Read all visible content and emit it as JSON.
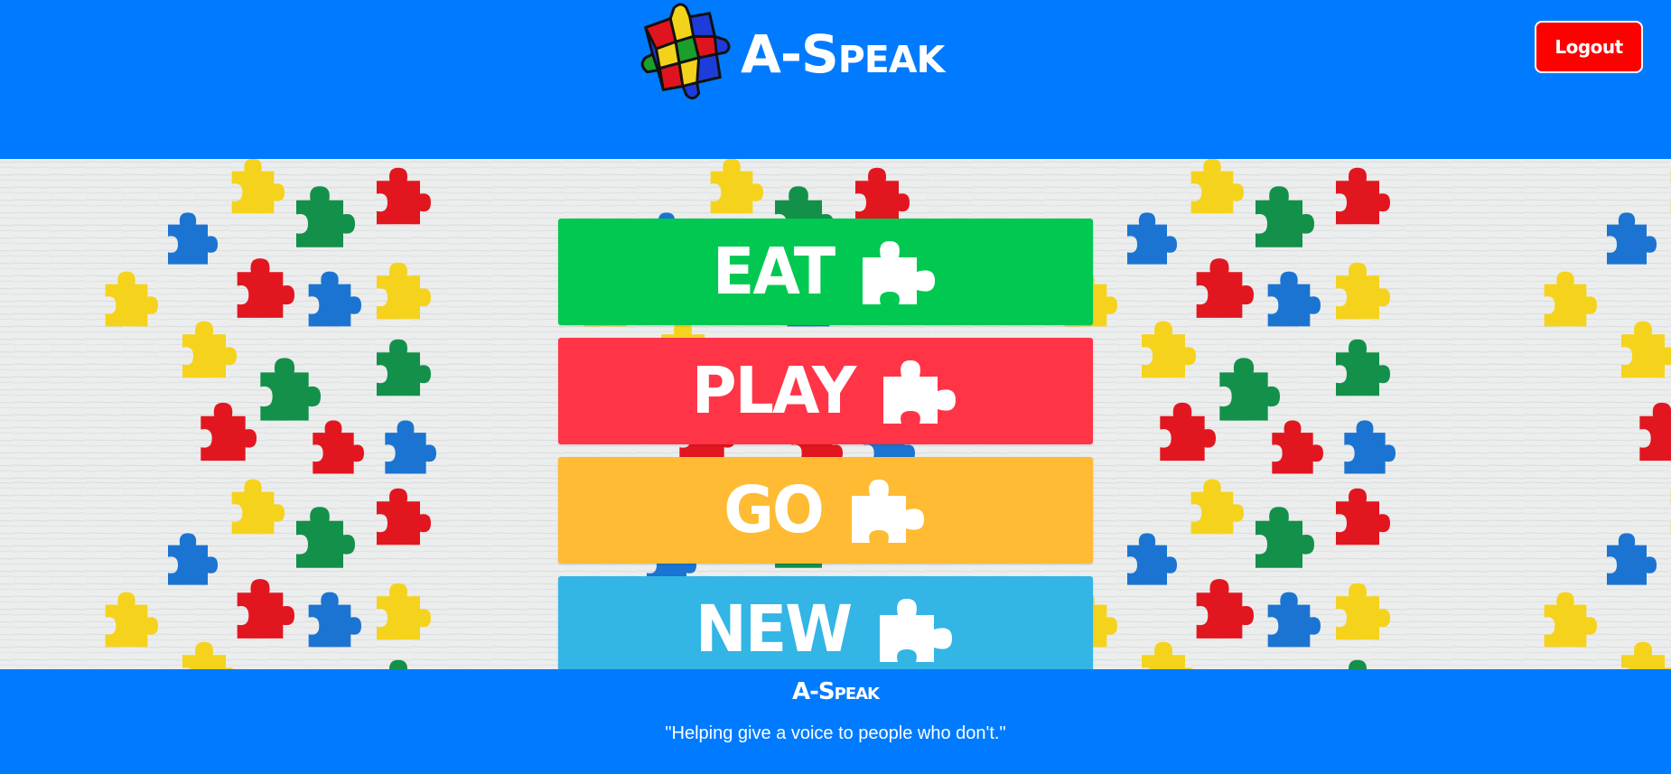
{
  "header": {
    "title": "A-Speak",
    "logout_label": "Logout",
    "logo_icon": "puzzle-logo-icon"
  },
  "menu": {
    "items": [
      {
        "label": "EAT",
        "color": "#00c851",
        "icon": "puzzle-piece-icon"
      },
      {
        "label": "PLAY",
        "color": "#ff3547",
        "icon": "puzzle-piece-icon"
      },
      {
        "label": "GO",
        "color": "#ffbb33",
        "icon": "puzzle-piece-icon"
      },
      {
        "label": "NEW",
        "color": "#33b5e5",
        "icon": "puzzle-piece-icon"
      }
    ]
  },
  "footer": {
    "title": "A-Speak",
    "tagline": "\"Helping give a voice to people who don't.\""
  },
  "colors": {
    "brand_blue": "#007bff",
    "logout_red": "#ff0000",
    "background": "#e9e9ea"
  }
}
